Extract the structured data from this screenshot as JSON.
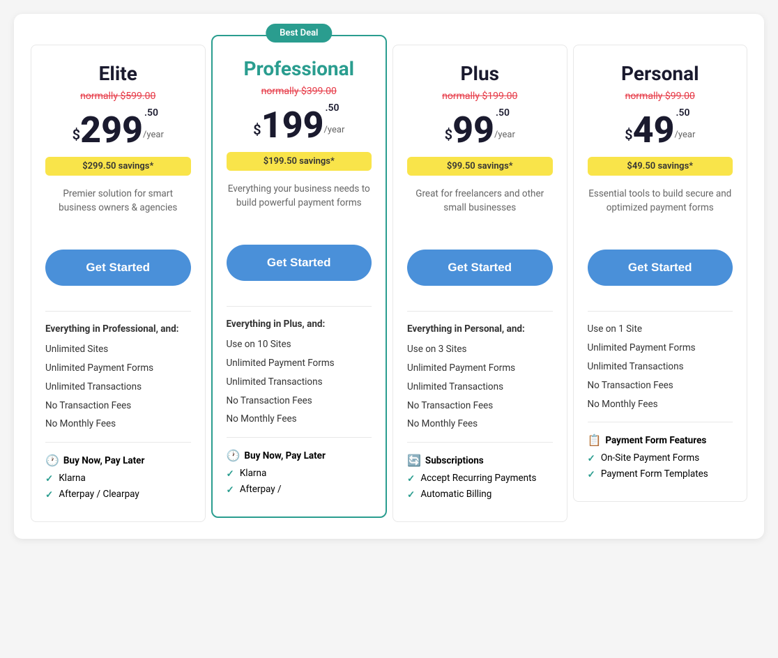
{
  "badge": "Best Deal",
  "plans": [
    {
      "id": "elite",
      "name": "Elite",
      "featured": false,
      "originalPrice": "normally $599.00",
      "priceMain": "299",
      "priceCents": ".50",
      "pricePeriod": "/year",
      "priceDollar": "$",
      "savings": "$299.50 savings*",
      "description": "Premier solution for smart business owners & agencies",
      "ctaLabel": "Get Started",
      "featuresHeader": "Everything in Professional, and:",
      "features": [
        "Unlimited Sites",
        "Unlimited Payment Forms",
        "Unlimited Transactions",
        "No Transaction Fees",
        "No Monthly Fees"
      ],
      "sectionHeader": "Buy Now, Pay Later",
      "sectionIcon": "🕐",
      "sectionItems": [
        "Klarna",
        "Afterpay / Clearpay"
      ]
    },
    {
      "id": "professional",
      "name": "Professional",
      "featured": true,
      "originalPrice": "normally $399.00",
      "priceMain": "199",
      "priceCents": ".50",
      "pricePeriod": "/year",
      "priceDollar": "$",
      "savings": "$199.50 savings*",
      "description": "Everything your business needs to build powerful payment forms",
      "ctaLabel": "Get Started",
      "featuresHeader": "Everything in Plus, and:",
      "features": [
        "Use on 10 Sites",
        "Unlimited Payment Forms",
        "Unlimited Transactions",
        "No Transaction Fees",
        "No Monthly Fees"
      ],
      "sectionHeader": "Buy Now, Pay Later",
      "sectionIcon": "🕐",
      "sectionItems": [
        "Klarna",
        "Afterpay /"
      ]
    },
    {
      "id": "plus",
      "name": "Plus",
      "featured": false,
      "originalPrice": "normally $199.00",
      "priceMain": "99",
      "priceCents": ".50",
      "pricePeriod": "/year",
      "priceDollar": "$",
      "savings": "$99.50 savings*",
      "description": "Great for freelancers and other small businesses",
      "ctaLabel": "Get Started",
      "featuresHeader": "Everything in Personal, and:",
      "features": [
        "Use on 3 Sites",
        "Unlimited Payment Forms",
        "Unlimited Transactions",
        "No Transaction Fees",
        "No Monthly Fees"
      ],
      "sectionHeader": "Subscriptions",
      "sectionIcon": "🔄",
      "sectionItems": [
        "Accept Recurring Payments",
        "Automatic Billing"
      ]
    },
    {
      "id": "personal",
      "name": "Personal",
      "featured": false,
      "originalPrice": "normally $99.00",
      "priceMain": "49",
      "priceCents": ".50",
      "pricePeriod": "/year",
      "priceDollar": "$",
      "savings": "$49.50 savings*",
      "description": "Essential tools to build secure and optimized payment forms",
      "ctaLabel": "Get Started",
      "featuresHeader": null,
      "features": [
        "Use on 1 Site",
        "Unlimited Payment Forms",
        "Unlimited Transactions",
        "No Transaction Fees",
        "No Monthly Fees"
      ],
      "sectionHeader": "Payment Form Features",
      "sectionIcon": "📋",
      "sectionItems": [
        "On-Site Payment Forms",
        "Payment Form Templates"
      ]
    }
  ]
}
